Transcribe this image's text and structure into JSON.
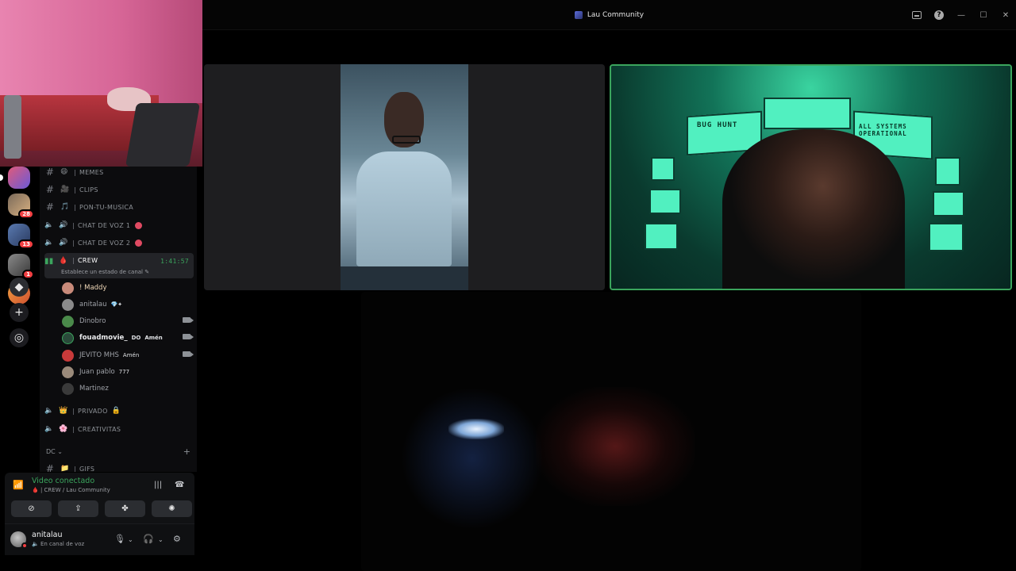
{
  "window": {
    "title": "Lau Community"
  },
  "guilds": [
    {
      "name": "guild-1",
      "badge": ""
    },
    {
      "name": "guild-2",
      "badge": "28"
    },
    {
      "name": "guild-3",
      "badge": "13"
    },
    {
      "name": "guild-4",
      "badge": "1"
    },
    {
      "name": "guild-5",
      "badge": ""
    }
  ],
  "channels": [
    {
      "type": "text",
      "emoji": "😄",
      "name": "MEMES"
    },
    {
      "type": "text",
      "emoji": "🎥",
      "name": "CLIPS"
    },
    {
      "type": "text",
      "emoji": "🎵",
      "name": "PON-TU-MUSICA"
    },
    {
      "type": "voice",
      "emoji": "🔊",
      "name": "CHAT DE VOZ 1"
    },
    {
      "type": "voice",
      "emoji": "🔊",
      "name": "CHAT DE VOZ 2"
    }
  ],
  "active_channel": {
    "emoji": "🩸",
    "name": "CREW",
    "timer": "1:41:57",
    "status": "Establece un estado de canal"
  },
  "voice_users": [
    {
      "name": "! Maddy",
      "tag": "",
      "tag2": "",
      "camera": false
    },
    {
      "name": "anitalau",
      "tag": "💎✦",
      "tag2": "",
      "camera": false
    },
    {
      "name": "Dinobro",
      "tag": "",
      "tag2": "",
      "camera": true
    },
    {
      "name": "fouadmovie_",
      "tag": "DO",
      "tag2": "Amén",
      "camera": true
    },
    {
      "name": "JEVITO MHS",
      "tag": "Amén",
      "tag2": "",
      "camera": true
    },
    {
      "name": "Juan pablo",
      "tag": "777",
      "tag2": "",
      "camera": false
    },
    {
      "name": "Martinez",
      "tag": "",
      "tag2": "",
      "camera": false
    }
  ],
  "more_channels": [
    {
      "type": "voice",
      "emoji": "👑",
      "name": "PRIVADO"
    },
    {
      "type": "voice",
      "emoji": "🌸",
      "name": "CREATIVITAS"
    }
  ],
  "category": {
    "name": "DC",
    "next_channel": "GIFS"
  },
  "voice_panel": {
    "title": "Video conectado",
    "subtitle": "| CREW / Lau Community"
  },
  "user_panel": {
    "username": "anitalau",
    "status": "En canal de voz"
  },
  "tiles": {
    "tile2_panel_a": "BUG HUNT",
    "tile2_panel_b": "ALL SYSTEMS OPERATIONAL"
  },
  "colors": {
    "accent_green": "#3ba55d",
    "badge_red": "#f23f42"
  }
}
